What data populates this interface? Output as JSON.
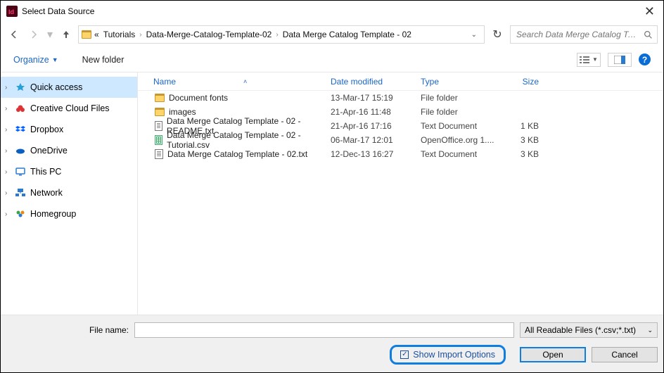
{
  "title": "Select Data Source",
  "breadcrumb": [
    "Tutorials",
    "Data-Merge-Catalog-Template-02",
    "Data Merge Catalog Template - 02"
  ],
  "search_placeholder": "Search Data Merge Catalog Te...",
  "toolbar": {
    "organize": "Organize",
    "newfolder": "New folder"
  },
  "sidebar": [
    {
      "label": "Quick access"
    },
    {
      "label": "Creative Cloud Files"
    },
    {
      "label": "Dropbox"
    },
    {
      "label": "OneDrive"
    },
    {
      "label": "This PC"
    },
    {
      "label": "Network"
    },
    {
      "label": "Homegroup"
    }
  ],
  "columns": {
    "name": "Name",
    "date": "Date modified",
    "type": "Type",
    "size": "Size"
  },
  "rows": [
    {
      "icon": "folder",
      "name": "Document fonts",
      "date": "13-Mar-17 15:19",
      "type": "File folder",
      "size": ""
    },
    {
      "icon": "folder",
      "name": "images",
      "date": "21-Apr-16 11:48",
      "type": "File folder",
      "size": ""
    },
    {
      "icon": "doc",
      "name": "Data Merge Catalog Template - 02 - README.txt",
      "date": "21-Apr-16 17:16",
      "type": "Text Document",
      "size": "1 KB"
    },
    {
      "icon": "csv",
      "name": "Data Merge Catalog Template - 02 - Tutorial.csv",
      "date": "06-Mar-17 12:01",
      "type": "OpenOffice.org 1....",
      "size": "3 KB"
    },
    {
      "icon": "doc",
      "name": "Data Merge Catalog Template - 02.txt",
      "date": "12-Dec-13 16:27",
      "type": "Text Document",
      "size": "3 KB"
    }
  ],
  "footer": {
    "filename_label": "File name:",
    "filter": "All Readable Files (*.csv;*.txt)",
    "show_import": "Show Import Options",
    "open": "Open",
    "cancel": "Cancel"
  },
  "help_ic": "?"
}
